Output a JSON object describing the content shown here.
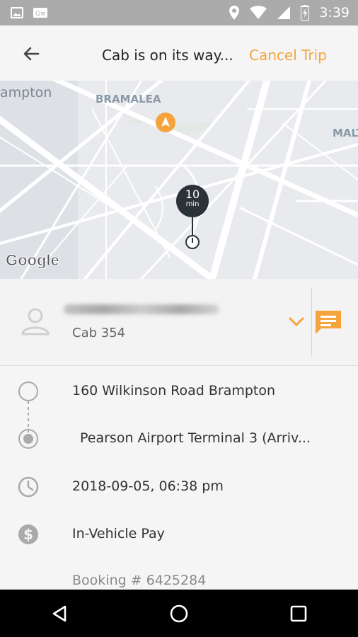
{
  "status_bar": {
    "time": "3:39"
  },
  "app_bar": {
    "title": "Cab is on its way...",
    "cancel": "Cancel Trip"
  },
  "map": {
    "labels": {
      "brampton": "ampton",
      "bramalea": "BRAMALEA",
      "malton": "MALT"
    },
    "eta_value": "10",
    "eta_unit": "min",
    "google": "Google"
  },
  "driver": {
    "cab": "Cab 354"
  },
  "trip": {
    "pickup": "160 Wilkinson Road Brampton",
    "dropoff": "Pearson Airport Terminal 3 (Arriv...",
    "datetime": "2018-09-05, 06:38 pm",
    "payment": "In-Vehicle Pay",
    "booking": "Booking # 6425284"
  },
  "colors": {
    "accent": "#f5a33d",
    "status_bar": "#ababab",
    "nav_bar": "#000000"
  }
}
